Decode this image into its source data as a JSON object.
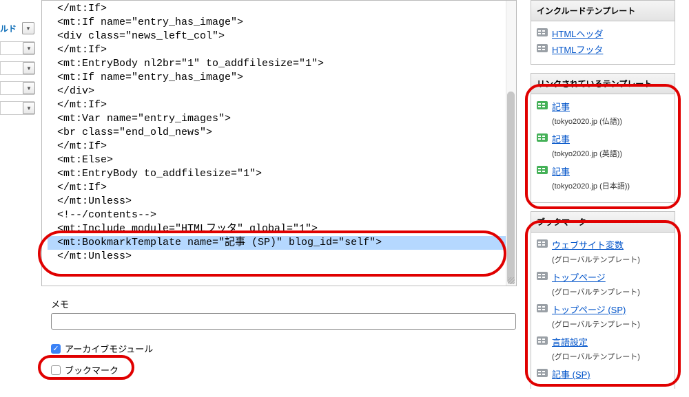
{
  "left": {
    "label": "ルド"
  },
  "code": {
    "lines": [
      "</mt:If>",
      "<mt:If name=\"entry_has_image\">",
      "<div class=\"news_left_col\">",
      "</mt:If>",
      "<mt:EntryBody nl2br=\"1\" to_addfilesize=\"1\">",
      "<mt:If name=\"entry_has_image\">",
      "</div>",
      "</mt:If>",
      "<mt:Var name=\"entry_images\">",
      "<br class=\"end_old_news\">",
      "</mt:If>",
      "<mt:Else>",
      "<mt:EntryBody to_addfilesize=\"1\">",
      "</mt:If>",
      "</mt:Unless>",
      "<!--/contents-->",
      "<mt:Include module=\"HTMLフッタ\" global=\"1\">",
      "<mt:BookmarkTemplate name=\"記事 (SP)\" blog_id=\"self\">",
      "</mt:Unless>"
    ],
    "highlighted_index": 17
  },
  "memo": {
    "label": "メモ",
    "value": ""
  },
  "checkboxes": {
    "archive_label": "アーカイブモジュール",
    "archive_checked": true,
    "bookmark_label": "ブックマーク",
    "bookmark_checked": false
  },
  "sidebar": {
    "include": {
      "title": "インクルードテンプレート",
      "items": [
        {
          "label": "HTMLヘッダ"
        },
        {
          "label": "HTMLフッタ"
        }
      ]
    },
    "linked": {
      "title": "リンクされているテンプレート",
      "items": [
        {
          "label": "記事",
          "sub": "(tokyo2020.jp (仏語))"
        },
        {
          "label": "記事",
          "sub": "(tokyo2020.jp (英語))"
        },
        {
          "label": "記事",
          "sub": "(tokyo2020.jp (日本語))"
        }
      ]
    },
    "bookmark": {
      "title": "ブックマーク",
      "items": [
        {
          "label": "ウェブサイト変数",
          "sub": "(グローバルテンプレート)"
        },
        {
          "label": "トップページ",
          "sub": "(グローバルテンプレート)"
        },
        {
          "label": "トップページ (SP)",
          "sub": "(グローバルテンプレート)"
        },
        {
          "label": "言語設定",
          "sub": "(グローバルテンプレート)"
        },
        {
          "label": "記事 (SP)",
          "sub": ""
        }
      ]
    }
  }
}
